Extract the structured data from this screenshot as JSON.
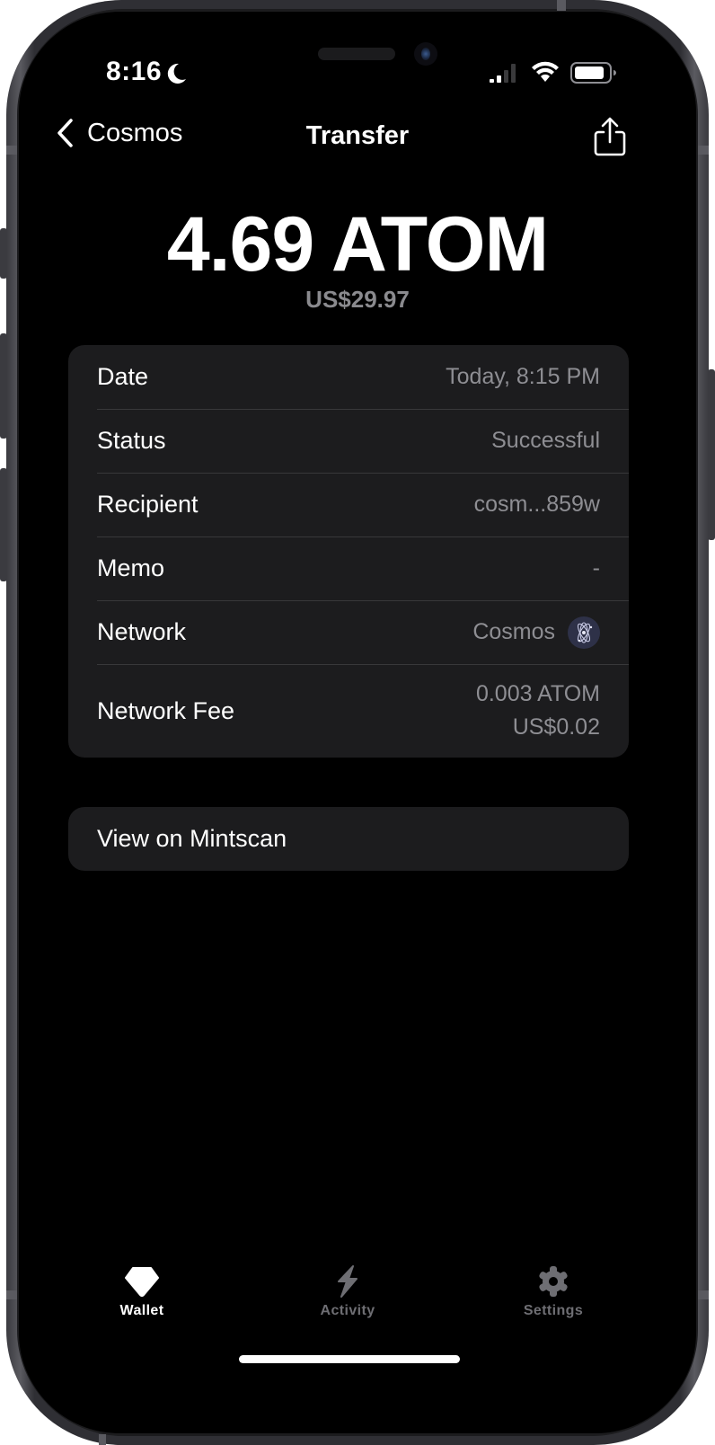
{
  "status_bar": {
    "time": "8:16",
    "focus_icon": "moon-icon",
    "signal_icon": "cellular-signal-icon",
    "wifi_icon": "wifi-icon",
    "battery_icon": "battery-icon"
  },
  "nav": {
    "back_label": "Cosmos",
    "title": "Transfer",
    "share_icon": "share-icon"
  },
  "transaction": {
    "amount": "4.69 ATOM",
    "fiat_amount": "US$29.97"
  },
  "details": [
    {
      "label": "Date",
      "value": "Today, 8:15 PM"
    },
    {
      "label": "Status",
      "value": "Successful"
    },
    {
      "label": "Recipient",
      "value": "cosm...859w"
    },
    {
      "label": "Memo",
      "value": "-"
    },
    {
      "label": "Network",
      "value": "Cosmos",
      "icon": "cosmos-network-icon"
    },
    {
      "label": "Network Fee",
      "value": "0.003 ATOM",
      "sub_value": "US$0.02"
    }
  ],
  "actions": {
    "view_explorer": "View on Mintscan"
  },
  "tabbar": {
    "active": "Wallet",
    "items": [
      {
        "label": "Wallet",
        "icon": "diamond-icon"
      },
      {
        "label": "Activity",
        "icon": "bolt-icon"
      },
      {
        "label": "Settings",
        "icon": "gear-icon"
      }
    ]
  },
  "colors": {
    "background": "#000000",
    "card": "#1c1c1e",
    "secondary_text": "#8e8e93",
    "inactive_tab": "#6e6e73",
    "network_badge": "#2e3148"
  }
}
